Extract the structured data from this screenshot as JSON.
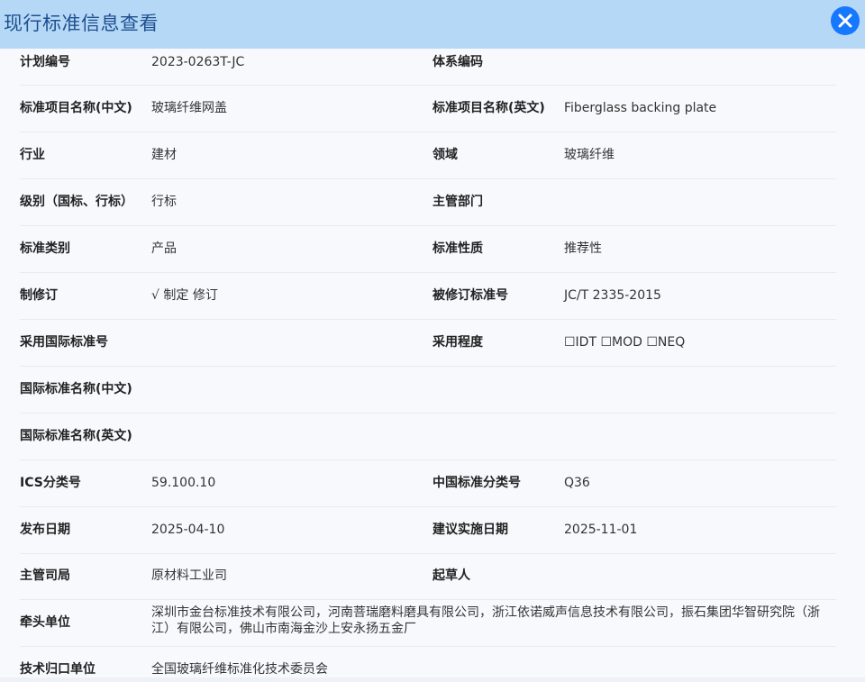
{
  "dialog": {
    "title": "现行标准信息查看",
    "close_icon": "close-icon"
  },
  "fields": {
    "plan_no": {
      "label": "计划编号",
      "value": "2023-0263T-JC"
    },
    "system_code": {
      "label": "体系编码",
      "value": ""
    },
    "name_cn": {
      "label": "标准项目名称(中文)",
      "value": "玻璃纤维网盖"
    },
    "name_en": {
      "label": "标准项目名称(英文)",
      "value": "Fiberglass backing plate"
    },
    "industry": {
      "label": "行业",
      "value": "建材"
    },
    "field": {
      "label": "领域",
      "value": "玻璃纤维"
    },
    "level": {
      "label": "级别（国标、行标）",
      "value": "行标"
    },
    "dept": {
      "label": "主管部门",
      "value": ""
    },
    "category": {
      "label": "标准类别",
      "value": "产品"
    },
    "nature": {
      "label": "标准性质",
      "value": "推荐性"
    },
    "revision": {
      "label": "制修订",
      "value": "√ 制定 修订"
    },
    "revised_no": {
      "label": "被修订标准号",
      "value": "JC/T 2335-2015"
    },
    "intl_no": {
      "label": "采用国际标准号",
      "value": ""
    },
    "adopt_degree": {
      "label": "采用程度",
      "value": "☐IDT ☐MOD ☐NEQ"
    },
    "intl_name_cn": {
      "label": "国际标准名称(中文)",
      "value": ""
    },
    "intl_name_en": {
      "label": "国际标准名称(英文)",
      "value": ""
    },
    "ics": {
      "label": "ICS分类号",
      "value": "59.100.10"
    },
    "ccs": {
      "label": "中国标准分类号",
      "value": "Q36"
    },
    "publish_date": {
      "label": "发布日期",
      "value": "2025-04-10"
    },
    "impl_date": {
      "label": "建议实施日期",
      "value": "2025-11-01"
    },
    "bureau": {
      "label": "主管司局",
      "value": "原材料工业司"
    },
    "drafter": {
      "label": "起草人",
      "value": ""
    },
    "lead_units": {
      "label": "牵头单位",
      "value": "深圳市金台标准技术有限公司，河南菩瑞磨料磨具有限公司，浙江依诺威声信息技术有限公司，振石集团华智研究院（浙江）有限公司，佛山市南海金沙上安永扬五金厂"
    },
    "tech_unit": {
      "label": "技术归口单位",
      "value": "全国玻璃纤维标准化技术委员会"
    }
  }
}
